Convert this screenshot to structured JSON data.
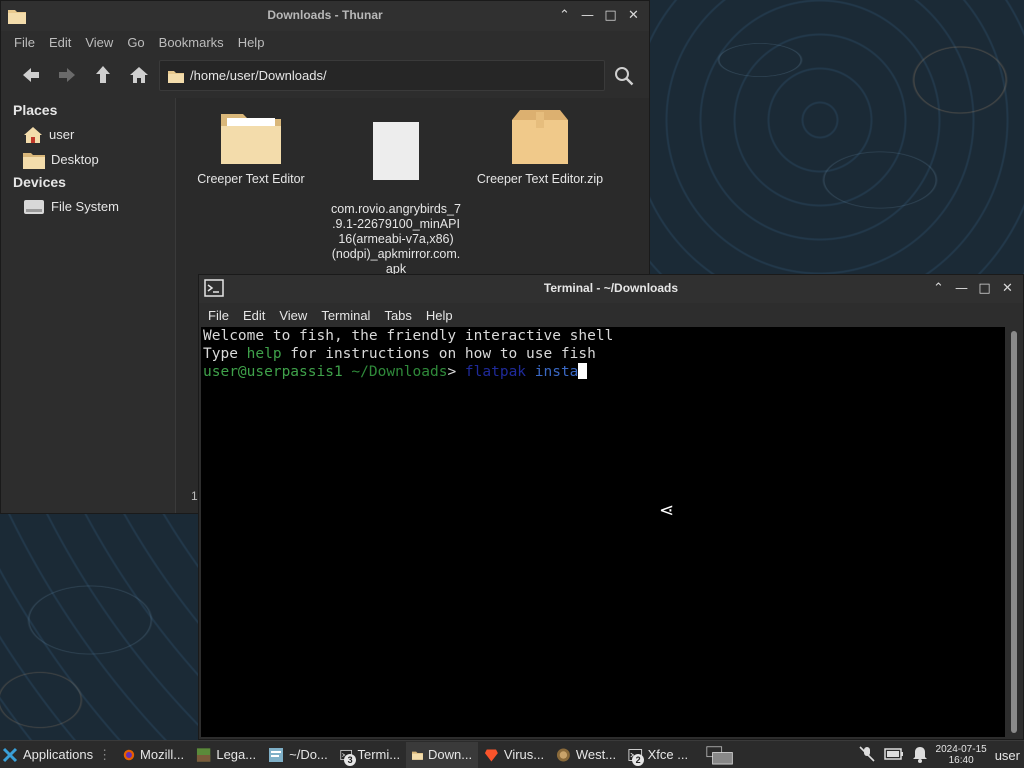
{
  "thunar": {
    "title": "Downloads - Thunar",
    "menu": [
      "File",
      "Edit",
      "View",
      "Go",
      "Bookmarks",
      "Help"
    ],
    "location": "/home/user/Downloads/",
    "sidebar": {
      "places_heading": "Places",
      "places": [
        "user",
        "Desktop"
      ],
      "devices_heading": "Devices",
      "devices": [
        "File System"
      ]
    },
    "files": [
      {
        "name": "Creeper Text Editor",
        "icon": "folder-icon"
      },
      {
        "name": "com.rovio.angrybirds_7\n.9.1-22679100_minAPI\n16(armeabi-v7a,x86)\n(nodpi)_apkmirror.com.\napk",
        "icon": "file-icon"
      },
      {
        "name": "Creeper Text Editor.zip",
        "icon": "archive-icon"
      }
    ],
    "status_fragment": "1"
  },
  "terminal": {
    "title": "Terminal - ~/Downloads",
    "menu": [
      "File",
      "Edit",
      "View",
      "Terminal",
      "Tabs",
      "Help"
    ],
    "lines": {
      "welcome": "Welcome to fish, the friendly interactive shell",
      "help_prefix": "Type ",
      "help_word": "help",
      "help_suffix": " for instructions on how to use fish",
      "prompt_user": "user@userpassis1",
      "prompt_path": " ~/Downloads",
      "prompt_symbol": "> ",
      "cmd": "flatpak",
      "cmd_arg": " insta"
    }
  },
  "taskbar": {
    "apps_label": "Applications",
    "tasks": [
      {
        "label": "Mozill...",
        "icon": "firefox-icon"
      },
      {
        "label": "Lega...",
        "icon": "minecraft-icon"
      },
      {
        "label": "~/Do...",
        "icon": "editor-icon"
      },
      {
        "label": "Termi...",
        "icon": "terminal-icon",
        "badge": "3"
      },
      {
        "label": "Down...",
        "icon": "folder-icon"
      },
      {
        "label": "Virus...",
        "icon": "brave-icon"
      },
      {
        "label": "West...",
        "icon": "game-icon"
      },
      {
        "label": "Xfce ...",
        "icon": "terminal-icon",
        "badge": "2"
      }
    ],
    "clock_date": "2024-07-15",
    "clock_time": "16:40",
    "user": "user"
  }
}
